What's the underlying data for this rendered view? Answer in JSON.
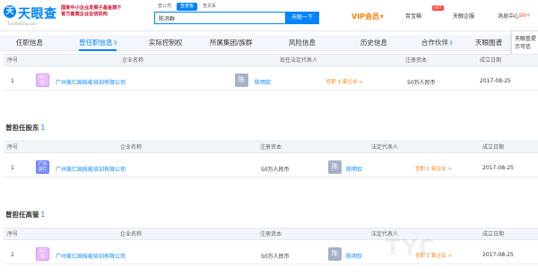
{
  "header": {
    "logo_mark": "天",
    "logo_text": "天眼查",
    "logo_url": "TianYanCha.com",
    "banner_line1": "国家中小企业发展子基金旗下",
    "banner_line2": "官方备案企业征信机构",
    "search_tabs": [
      "查公司",
      "查老板",
      "查关系"
    ],
    "search_value": "陈鸿群",
    "search_button": "天眼一下",
    "vip_label": "VIP会员",
    "nav_items": [
      "百宝箱",
      "天眼企服",
      "消息中心"
    ],
    "hot_badge": "HOT",
    "msg_count": "99+"
  },
  "tabs": [
    {
      "label": "任职信息",
      "count": ""
    },
    {
      "label": "曾任职信息",
      "count": "3"
    },
    {
      "label": "实际控制权",
      "count": ""
    },
    {
      "label": "所属集团/族群",
      "count": ""
    },
    {
      "label": "风险信息",
      "count": ""
    },
    {
      "label": "历史信息",
      "count": ""
    },
    {
      "label": "合作伙伴",
      "count": "3"
    },
    {
      "label": "天眼图谱",
      "count": ""
    }
  ],
  "tooltip": "天眼查提示可信",
  "sections": {
    "legal_rep": {
      "headers": [
        "序号",
        "企业名称",
        "现任法定代表人",
        "注册资本",
        "成立日期"
      ],
      "rows": [
        {
          "idx": "1",
          "logo": "美仁国",
          "company": "广州美仁国技能培训有限公司",
          "avatar": "陈",
          "person": "陈明钦",
          "relation": "任职 1 家企业 >",
          "capital": "50万人民币",
          "date": "2017-08-25"
        }
      ]
    },
    "shareholder": {
      "title": "曾担任股东",
      "count": "1",
      "headers": [
        "序号",
        "企业名称",
        "注册资本",
        "法定代表人",
        "成立日期"
      ],
      "rows": [
        {
          "idx": "1",
          "logo": "广州美仁",
          "company": "广州美仁国技能培训有限公司",
          "capital": "50万人民币",
          "avatar": "陈",
          "person": "陈明钦",
          "relation": "任职 1 家企业 >",
          "date": "2017-08-25"
        }
      ]
    },
    "executive": {
      "title": "曾担任高管",
      "count": "1",
      "headers": [
        "序号",
        "企业名称",
        "注册资本",
        "法定代表人",
        "成立日期"
      ],
      "rows": [
        {
          "idx": "1",
          "logo": "美仁国",
          "company": "广州美仁国技能培训有限公司",
          "capital": "50万人民币",
          "avatar": "陈",
          "person": "陈明钦",
          "relation": "任职 1 家企业 >",
          "date": "2017-08-25"
        }
      ]
    }
  },
  "watermark": "TYC",
  "colors": {
    "accent": "#0084ff",
    "vip": "#ff7f00",
    "hot": "#ff4848"
  }
}
